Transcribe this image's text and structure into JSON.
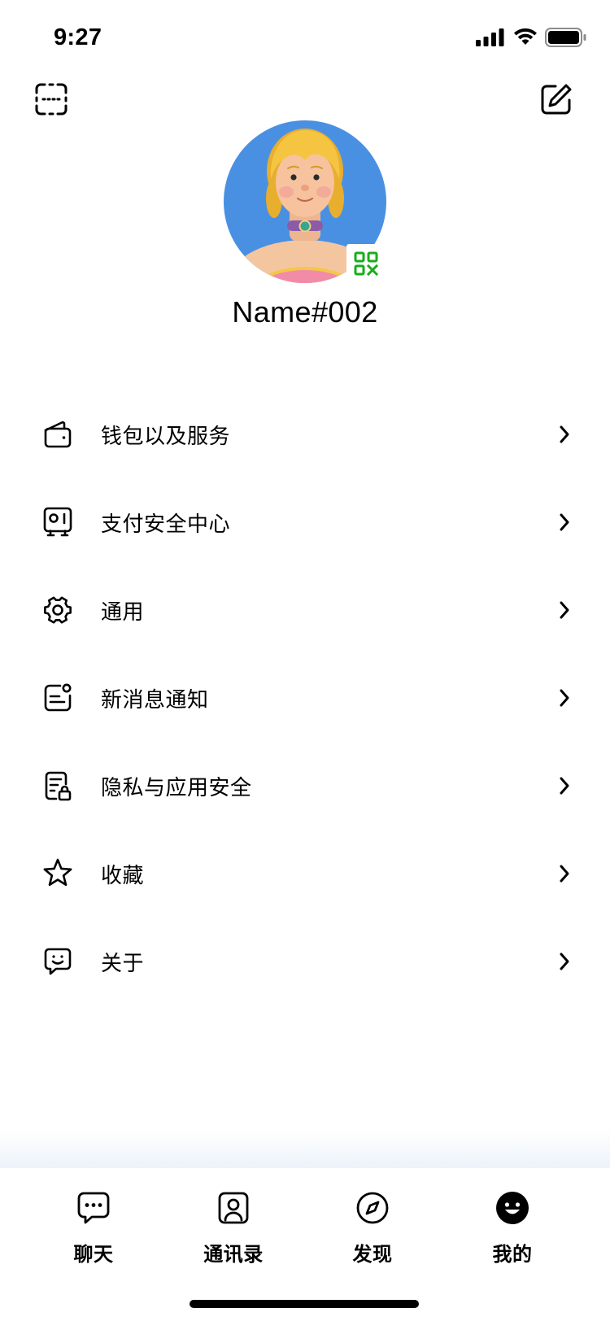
{
  "status_bar": {
    "time": "9:27",
    "battery_level": 1.0,
    "icons": [
      "cellular-signal-icon",
      "wifi-icon",
      "battery-icon"
    ]
  },
  "header": {
    "left_icon": "scan-icon",
    "right_icon": "edit-icon"
  },
  "profile": {
    "name": "Name#002",
    "qr_icon": "qr-code-icon"
  },
  "menu": {
    "items": [
      {
        "label": "钱包以及服务",
        "icon": "wallet-icon"
      },
      {
        "label": "支付安全中心",
        "icon": "payment-security-icon"
      },
      {
        "label": "通用",
        "icon": "gear-icon"
      },
      {
        "label": "新消息通知",
        "icon": "notification-icon"
      },
      {
        "label": "隐私与应用安全",
        "icon": "privacy-lock-icon"
      },
      {
        "label": "收藏",
        "icon": "star-icon"
      },
      {
        "label": "关于",
        "icon": "smiley-chat-icon"
      }
    ]
  },
  "tab_bar": {
    "items": [
      {
        "label": "聊天",
        "icon": "chat-icon",
        "active": false
      },
      {
        "label": "通讯录",
        "icon": "contacts-icon",
        "active": false
      },
      {
        "label": "发现",
        "icon": "compass-icon",
        "active": false
      },
      {
        "label": "我的",
        "icon": "profile-icon",
        "active": true
      }
    ]
  },
  "colors": {
    "text": "#000000",
    "background": "#FFFFFF",
    "avatar_background": "#4A90E2",
    "qr_accent": "#1AAD19",
    "tab_fade": "#EDF3FA"
  }
}
